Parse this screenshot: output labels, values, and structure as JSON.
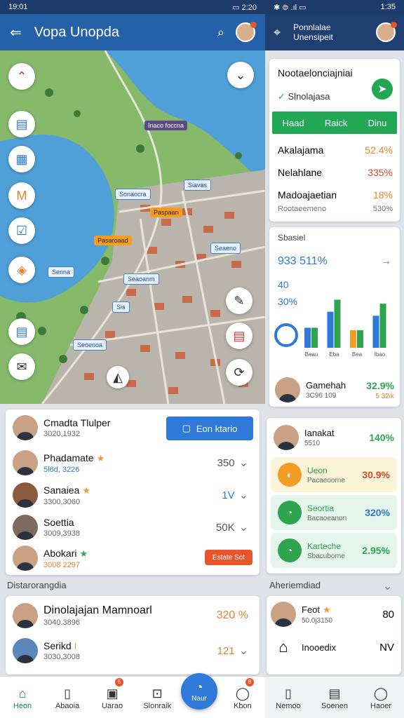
{
  "status": {
    "time_left": "19:01",
    "time_right": "1:35",
    "icons_left": "✱ ⊜ .ıl ▭",
    "battery_left": "▭ 2:20"
  },
  "appbar": {
    "title": "Vopa Unopda"
  },
  "right_header": {
    "line1": "Ponnlalae",
    "line2": "Unensipeit"
  },
  "map": {
    "labels": [
      {
        "text": "Inaco foccna",
        "style": "dark"
      },
      {
        "text": "Siavas",
        "style": "blue"
      },
      {
        "text": "Sonaocra",
        "style": "blue"
      },
      {
        "text": "Paspaan",
        "style": "orange"
      },
      {
        "text": "Pasaroaad",
        "style": "orange"
      },
      {
        "text": "Seaeno",
        "style": "blue"
      },
      {
        "text": "Senna",
        "style": "blue"
      },
      {
        "text": "Seaoanm",
        "style": "blue"
      },
      {
        "text": "Sis",
        "style": "blue"
      },
      {
        "text": "Seoenoa",
        "style": "blue"
      }
    ]
  },
  "contacts": {
    "button": "Eon ktario",
    "rows": [
      {
        "name": "Cmadta Tlulper",
        "sub": "3020,1932",
        "value": "",
        "star": false
      },
      {
        "name": "Phadamate",
        "sub": "5l6d, 3226",
        "value": "350",
        "star": true
      },
      {
        "name": "Sanaiea",
        "sub": "3300,3060",
        "value": "1V",
        "star": true
      },
      {
        "name": "Soettia",
        "sub": "3009,3938",
        "value": "50K",
        "star": false
      },
      {
        "name": "Abokari",
        "sub": "3008 2297",
        "value": "",
        "star": true
      }
    ],
    "action": "Estate Sot"
  },
  "section2": {
    "header": "Distarorangdia",
    "rows": [
      {
        "name": "Dinolajajan Mamnoarl",
        "sub": "3040.3896",
        "value": "320 %"
      },
      {
        "name": "Serikd",
        "sub": "3030,3008",
        "value": "121"
      }
    ]
  },
  "bottom_nav": [
    {
      "label": "Heon",
      "icon": "⌂"
    },
    {
      "label": "Abaoia",
      "icon": "▯"
    },
    {
      "label": "Uarao",
      "icon": "▣"
    },
    {
      "label": "Slonraik",
      "icon": "⊡"
    },
    {
      "label": "Kbon",
      "icon": "◯"
    }
  ],
  "bottom_center": {
    "label": "Naur",
    "icon": "◔"
  },
  "right_panel": {
    "card1": {
      "title": "Nootaelonciajniai",
      "subtitle": "Slnolajasa",
      "tabs": [
        "Haad",
        "Raick",
        "Dinu"
      ],
      "rows": [
        {
          "name": "Akalajama",
          "value": "52.4%"
        },
        {
          "name": "Nelahlane",
          "value": "335%"
        },
        {
          "name": "Madoajaetian",
          "value": "18%"
        },
        {
          "name": "Rootaeemeno",
          "value": "530%"
        }
      ]
    },
    "card2": {
      "header": "Sbasiel",
      "big": "933 511%",
      "v1": "40",
      "v2": "30%",
      "person": "Gamehah",
      "person_sub": "3C96 109",
      "person_val": "32.9%",
      "person_val2": "5 32ik"
    },
    "card3": {
      "rows": [
        {
          "name": "Ianakat",
          "sub": "5510",
          "value": "140%"
        },
        {
          "name": "Ueon",
          "sub": "Pacaeoorne",
          "value": "30.9%"
        },
        {
          "name": "Seortia",
          "sub": "Bacaoeanon",
          "value": "320%"
        },
        {
          "name": "Karteche",
          "sub": "Sbacuborne",
          "value": "2.95%"
        }
      ]
    },
    "section": {
      "header": "Aheriemdiad"
    },
    "card4": {
      "rows": [
        {
          "name": "Feot",
          "sub": "50.0j3150",
          "value": "80"
        },
        {
          "name": "Inooedix",
          "sub": "",
          "value": "NV"
        }
      ]
    },
    "nav": [
      {
        "label": "Nemoo",
        "icon": "▯"
      },
      {
        "label": "Soenen",
        "icon": "▤"
      },
      {
        "label": "Haoer",
        "icon": "◯"
      }
    ]
  },
  "chart_data": {
    "type": "bar",
    "categories": [
      "Beau",
      "Eba",
      "Bea",
      "Ibao"
    ],
    "series": [
      {
        "values": [
          25,
          45,
          22,
          40
        ],
        "color": "#2f7ad8"
      },
      {
        "values": [
          25,
          60,
          22,
          55
        ],
        "color": "#2ea44f"
      }
    ],
    "ylim": [
      0,
      70
    ]
  },
  "colors": {
    "primary": "#2461a8",
    "accent_green": "#22a854",
    "accent_orange": "#e8822b",
    "accent_red": "#e8542b"
  }
}
